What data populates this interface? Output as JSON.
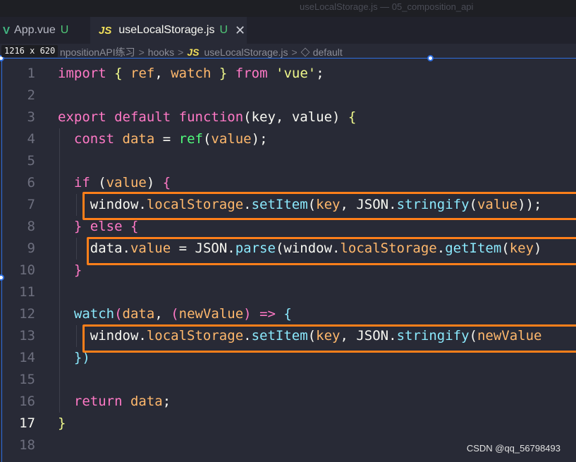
{
  "window": {
    "title": "useLocalStorage.js — 05_composition_api"
  },
  "tabs": [
    {
      "icon": "vue-icon",
      "label": "App.vue",
      "status": "U"
    },
    {
      "icon": "js-icon",
      "label": "useLocalStorage.js",
      "status": "U",
      "close": "✕"
    }
  ],
  "overlay": {
    "size_label": "1216 x 620"
  },
  "breadcrumb": {
    "items": [
      "npositionAPI练习",
      "hooks",
      "useLocalStorage.js",
      "default"
    ],
    "js_badge": "JS",
    "separator": ">"
  },
  "editor": {
    "active_line": 17,
    "lines": [
      {
        "num": "1",
        "tokens": [
          [
            "kw",
            "import"
          ],
          [
            "pl",
            " "
          ],
          [
            "br",
            "{"
          ],
          [
            "pl",
            " "
          ],
          [
            "param",
            "ref"
          ],
          [
            "pl",
            ", "
          ],
          [
            "param",
            "watch"
          ],
          [
            "pl",
            " "
          ],
          [
            "br",
            "}"
          ],
          [
            "pl",
            " "
          ],
          [
            "kw",
            "from"
          ],
          [
            "pl",
            " "
          ],
          [
            "str",
            "'vue'"
          ],
          [
            "pl",
            ";"
          ]
        ]
      },
      {
        "num": "2",
        "tokens": []
      },
      {
        "num": "3",
        "tokens": [
          [
            "kw",
            "export"
          ],
          [
            "pl",
            " "
          ],
          [
            "kw",
            "default"
          ],
          [
            "pl",
            " "
          ],
          [
            "kw",
            "function"
          ],
          [
            "pl",
            "("
          ],
          [
            "pl",
            "key"
          ],
          [
            "pl",
            ", "
          ],
          [
            "pl",
            "value"
          ],
          [
            "pl",
            ") "
          ],
          [
            "br",
            "{"
          ]
        ]
      },
      {
        "num": "4",
        "tokens": [
          [
            "pl",
            "  "
          ],
          [
            "kw",
            "const"
          ],
          [
            "pl",
            " "
          ],
          [
            "param",
            "data"
          ],
          [
            "pl",
            " = "
          ],
          [
            "fn",
            "ref"
          ],
          [
            "pl",
            "("
          ],
          [
            "param",
            "value"
          ],
          [
            "pl",
            ");"
          ]
        ]
      },
      {
        "num": "5",
        "tokens": []
      },
      {
        "num": "6",
        "tokens": [
          [
            "pl",
            "  "
          ],
          [
            "kw",
            "if"
          ],
          [
            "pl",
            " ("
          ],
          [
            "param",
            "value"
          ],
          [
            "pl",
            ") "
          ],
          [
            "kw",
            "{"
          ]
        ]
      },
      {
        "num": "7",
        "tokens": [
          [
            "pl",
            "    "
          ],
          [
            "pl",
            "window"
          ],
          [
            "pl",
            "."
          ],
          [
            "param",
            "localStorage"
          ],
          [
            "pl",
            "."
          ],
          [
            "prop",
            "setItem"
          ],
          [
            "pl",
            "("
          ],
          [
            "param",
            "key"
          ],
          [
            "pl",
            ", "
          ],
          [
            "pl",
            "JSON"
          ],
          [
            "pl",
            "."
          ],
          [
            "prop",
            "stringify"
          ],
          [
            "pl",
            "("
          ],
          [
            "param",
            "value"
          ],
          [
            "pl",
            "));"
          ]
        ]
      },
      {
        "num": "8",
        "tokens": [
          [
            "pl",
            "  "
          ],
          [
            "kw",
            "}"
          ],
          [
            "pl",
            " "
          ],
          [
            "kw",
            "else"
          ],
          [
            "pl",
            " "
          ],
          [
            "kw",
            "{"
          ]
        ]
      },
      {
        "num": "9",
        "tokens": [
          [
            "pl",
            "    "
          ],
          [
            "pl",
            "data"
          ],
          [
            "pl",
            "."
          ],
          [
            "param",
            "value"
          ],
          [
            "pl",
            " = "
          ],
          [
            "pl",
            "JSON"
          ],
          [
            "pl",
            "."
          ],
          [
            "prop",
            "parse"
          ],
          [
            "pl",
            "(window."
          ],
          [
            "param",
            "localStorage"
          ],
          [
            "pl",
            "."
          ],
          [
            "prop",
            "getItem"
          ],
          [
            "pl",
            "("
          ],
          [
            "param",
            "key"
          ],
          [
            "pl",
            ")"
          ]
        ]
      },
      {
        "num": "10",
        "tokens": [
          [
            "pl",
            "  "
          ],
          [
            "kw",
            "}"
          ]
        ]
      },
      {
        "num": "11",
        "tokens": []
      },
      {
        "num": "12",
        "tokens": [
          [
            "pl",
            "  "
          ],
          [
            "prop",
            "watch"
          ],
          [
            "kw",
            "("
          ],
          [
            "param",
            "data"
          ],
          [
            "pl",
            ", "
          ],
          [
            "kw",
            "("
          ],
          [
            "param",
            "newValue"
          ],
          [
            "kw",
            ")"
          ],
          [
            "pl",
            " "
          ],
          [
            "kw",
            "=>"
          ],
          [
            "pl",
            " "
          ],
          [
            "prop",
            "{"
          ]
        ]
      },
      {
        "num": "13",
        "tokens": [
          [
            "pl",
            "    "
          ],
          [
            "pl",
            "window"
          ],
          [
            "pl",
            "."
          ],
          [
            "param",
            "localStorage"
          ],
          [
            "pl",
            "."
          ],
          [
            "prop",
            "setItem"
          ],
          [
            "pl",
            "("
          ],
          [
            "param",
            "key"
          ],
          [
            "pl",
            ", "
          ],
          [
            "pl",
            "JSON"
          ],
          [
            "pl",
            "."
          ],
          [
            "prop",
            "stringify"
          ],
          [
            "pl",
            "("
          ],
          [
            "param",
            "newValue"
          ]
        ]
      },
      {
        "num": "14",
        "tokens": [
          [
            "pl",
            "  "
          ],
          [
            "prop",
            "})"
          ]
        ]
      },
      {
        "num": "15",
        "tokens": []
      },
      {
        "num": "16",
        "tokens": [
          [
            "pl",
            "  "
          ],
          [
            "kw",
            "return"
          ],
          [
            "pl",
            " "
          ],
          [
            "param",
            "data"
          ],
          [
            "pl",
            ";"
          ]
        ]
      },
      {
        "num": "17",
        "tokens": [
          [
            "br",
            "}"
          ]
        ]
      },
      {
        "num": "18",
        "tokens": []
      }
    ]
  },
  "watermark": "CSDN @qq_56798493",
  "colors": {
    "highlight_box": "#ff7f1a",
    "selection_frame": "#2f6fe0",
    "editor_bg": "#282a36"
  }
}
